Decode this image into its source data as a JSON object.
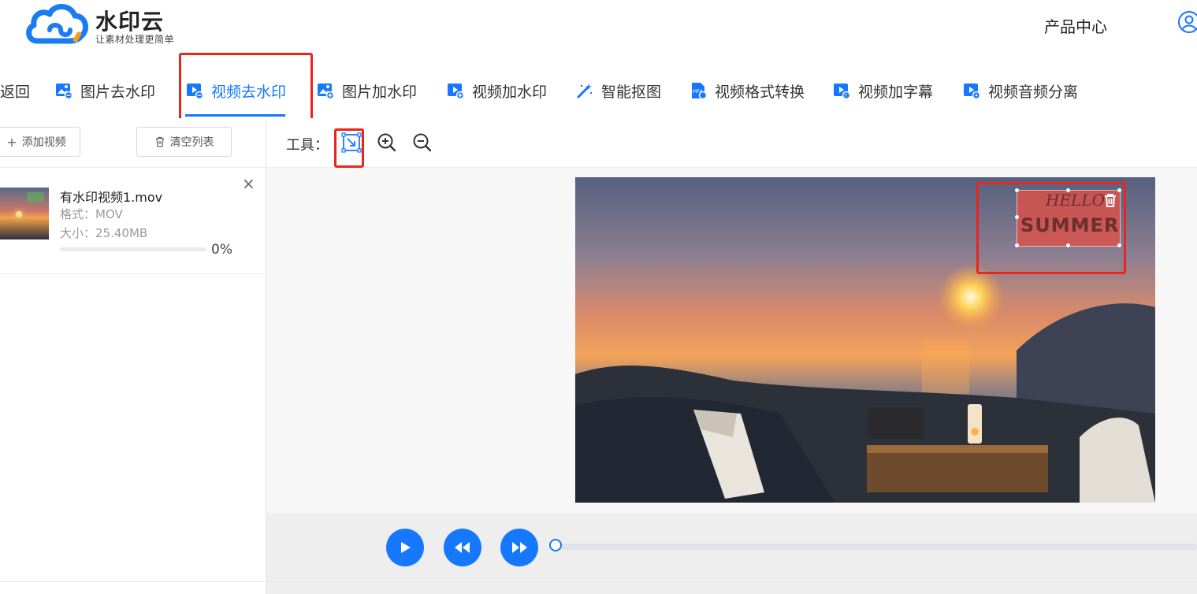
{
  "header": {
    "brand_name": "水印云",
    "brand_slogan": "让素材处理更简单",
    "nav_products": "产品中心",
    "accent_color": "#1677ff"
  },
  "tabs": [
    {
      "label": "返回",
      "icon": "none"
    },
    {
      "label": "图片去水印",
      "icon": "image-remove-icon"
    },
    {
      "label": "视频去水印",
      "icon": "video-remove-icon",
      "active": true
    },
    {
      "label": "图片加水印",
      "icon": "image-add-icon"
    },
    {
      "label": "视频加水印",
      "icon": "video-add-icon"
    },
    {
      "label": "智能抠图",
      "icon": "magic-wand-icon"
    },
    {
      "label": "视频格式转换",
      "icon": "mp4-convert-icon"
    },
    {
      "label": "视频加字幕",
      "icon": "video-subtitle-icon"
    },
    {
      "label": "视频音频分离",
      "icon": "video-audio-split-icon"
    }
  ],
  "left_panel": {
    "add_video_label": "添加视频",
    "clear_list_label": "清空列表",
    "file": {
      "name": "有水印视频1.mov",
      "format_label": "格式：MOV",
      "size_label": "大小：25.40MB",
      "progress": 0,
      "progress_text": "0%"
    }
  },
  "toolbar": {
    "label": "工具："
  },
  "video": {
    "watermark_line1": "HELLO",
    "watermark_line2": "SUMMER"
  },
  "player": {
    "position": 0
  },
  "annotation_color": "#e8261f"
}
